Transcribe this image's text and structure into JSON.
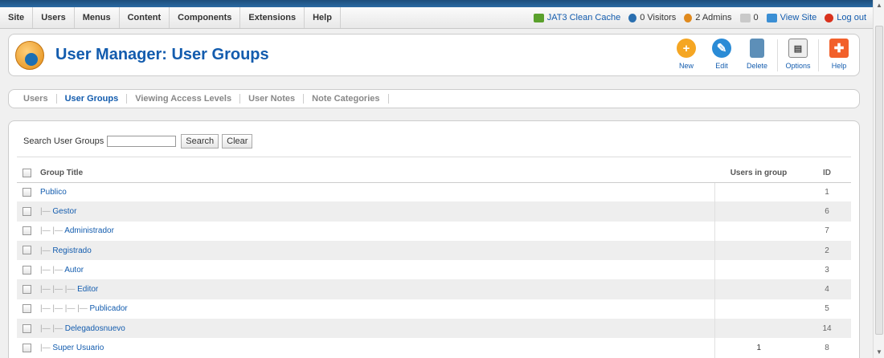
{
  "menu": [
    "Site",
    "Users",
    "Menus",
    "Content",
    "Components",
    "Extensions",
    "Help"
  ],
  "status": {
    "clean_cache": "JAT3 Clean Cache",
    "visitors": "0 Visitors",
    "admins": "2 Admins",
    "messages": "0",
    "view_site": "View Site",
    "logout": "Log out"
  },
  "header": {
    "title": "User Manager: User Groups"
  },
  "toolbar": [
    {
      "key": "new",
      "label": "New",
      "icon": "plus-icon"
    },
    {
      "key": "edit",
      "label": "Edit",
      "icon": "pencil-icon"
    },
    {
      "key": "delete",
      "label": "Delete",
      "icon": "trash-icon"
    },
    {
      "key": "options",
      "label": "Options",
      "icon": "options-icon"
    },
    {
      "key": "help",
      "label": "Help",
      "icon": "help-icon"
    }
  ],
  "subnav": [
    {
      "label": "Users",
      "active": false
    },
    {
      "label": "User Groups",
      "active": true
    },
    {
      "label": "Viewing Access Levels",
      "active": false
    },
    {
      "label": "User Notes",
      "active": false
    },
    {
      "label": "Note Categories",
      "active": false
    }
  ],
  "filter": {
    "label": "Search User Groups",
    "value": "",
    "search_label": "Search",
    "clear_label": "Clear"
  },
  "table": {
    "headers": {
      "title": "Group Title",
      "users": "Users in group",
      "id": "ID"
    },
    "rows": [
      {
        "depth": 0,
        "title": "Publico",
        "users": "",
        "id": "1"
      },
      {
        "depth": 1,
        "title": "Gestor",
        "users": "",
        "id": "6"
      },
      {
        "depth": 2,
        "title": "Administrador",
        "users": "",
        "id": "7"
      },
      {
        "depth": 1,
        "title": "Registrado",
        "users": "",
        "id": "2"
      },
      {
        "depth": 2,
        "title": "Autor",
        "users": "",
        "id": "3"
      },
      {
        "depth": 3,
        "title": "Editor",
        "users": "",
        "id": "4"
      },
      {
        "depth": 4,
        "title": "Publicador",
        "users": "",
        "id": "5"
      },
      {
        "depth": 2,
        "title": "Delegadosnuevo",
        "users": "",
        "id": "14"
      },
      {
        "depth": 1,
        "title": "Super Usuario",
        "users": "1",
        "id": "8"
      }
    ]
  }
}
